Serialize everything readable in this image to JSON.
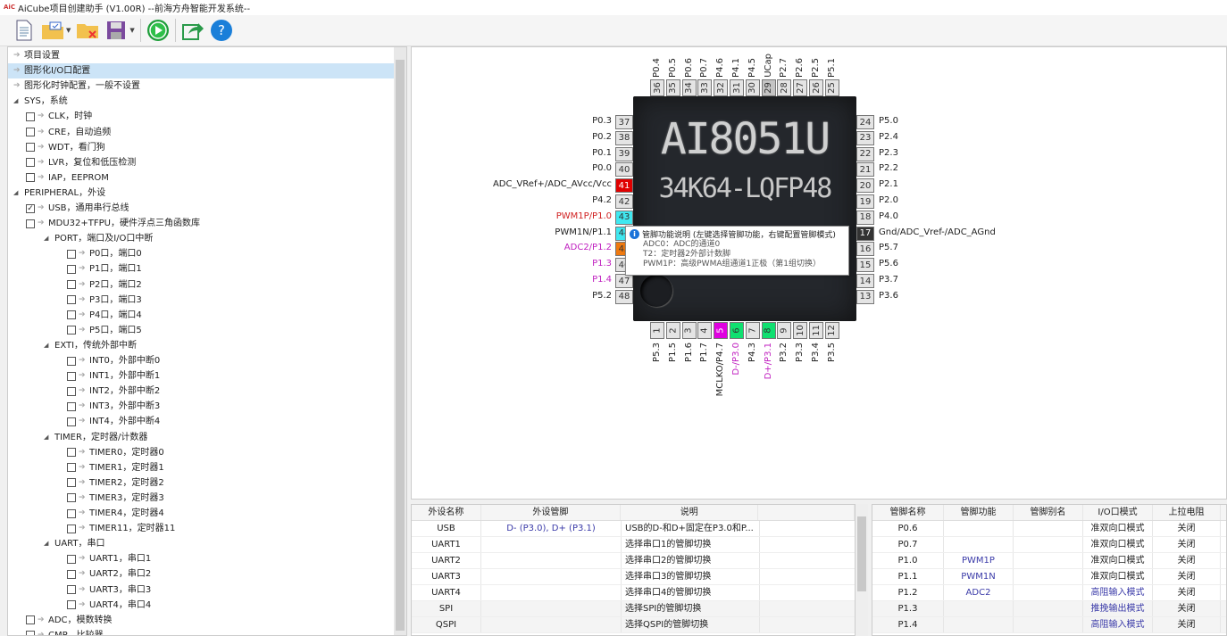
{
  "window": {
    "title": "AiCube项目创建助手 (V1.00R) --前海方舟智能开发系统--",
    "logo": "AiC Cube"
  },
  "toolbar": [
    "new-file-icon",
    "open-project-icon",
    "close-project-icon",
    "save-icon",
    "run-icon",
    "export-icon",
    "help-icon"
  ],
  "tree": [
    {
      "label": "项目设置",
      "level": 0,
      "type": "arrow"
    },
    {
      "label": "图形化I/O口配置",
      "level": 0,
      "type": "arrow",
      "selected": true
    },
    {
      "label": "图形化时钟配置，一般不设置",
      "level": 0,
      "type": "arrow"
    },
    {
      "label": "SYS，系统",
      "level": 0,
      "type": "group"
    },
    {
      "label": "CLK，时钟",
      "level": 1,
      "type": "check"
    },
    {
      "label": "CRE，自动追频",
      "level": 1,
      "type": "check"
    },
    {
      "label": "WDT，看门狗",
      "level": 1,
      "type": "check"
    },
    {
      "label": "LVR，复位和低压检测",
      "level": 1,
      "type": "check"
    },
    {
      "label": "IAP，EEPROM",
      "level": 1,
      "type": "check"
    },
    {
      "label": "PERIPHERAL，外设",
      "level": 0,
      "type": "group"
    },
    {
      "label": "USB，通用串行总线",
      "level": 1,
      "type": "check",
      "checked": true
    },
    {
      "label": "MDU32+TFPU，硬件浮点三角函数库",
      "level": 1,
      "type": "check"
    },
    {
      "label": "PORT，端口及I/O口中断",
      "level": 2,
      "type": "group"
    },
    {
      "label": "P0口，端口0",
      "level": 3,
      "type": "check"
    },
    {
      "label": "P1口，端口1",
      "level": 3,
      "type": "check"
    },
    {
      "label": "P2口，端口2",
      "level": 3,
      "type": "check"
    },
    {
      "label": "P3口，端口3",
      "level": 3,
      "type": "check"
    },
    {
      "label": "P4口，端口4",
      "level": 3,
      "type": "check"
    },
    {
      "label": "P5口，端口5",
      "level": 3,
      "type": "check"
    },
    {
      "label": "EXTI，传统外部中断",
      "level": 2,
      "type": "group"
    },
    {
      "label": "INT0，外部中断0",
      "level": 3,
      "type": "check"
    },
    {
      "label": "INT1，外部中断1",
      "level": 3,
      "type": "check"
    },
    {
      "label": "INT2，外部中断2",
      "level": 3,
      "type": "check"
    },
    {
      "label": "INT3，外部中断3",
      "level": 3,
      "type": "check"
    },
    {
      "label": "INT4，外部中断4",
      "level": 3,
      "type": "check"
    },
    {
      "label": "TIMER，定时器/计数器",
      "level": 2,
      "type": "group"
    },
    {
      "label": "TIMER0，定时器0",
      "level": 3,
      "type": "check"
    },
    {
      "label": "TIMER1，定时器1",
      "level": 3,
      "type": "check"
    },
    {
      "label": "TIMER2，定时器2",
      "level": 3,
      "type": "check"
    },
    {
      "label": "TIMER3，定时器3",
      "level": 3,
      "type": "check"
    },
    {
      "label": "TIMER4，定时器4",
      "level": 3,
      "type": "check"
    },
    {
      "label": "TIMER11，定时器11",
      "level": 3,
      "type": "check"
    },
    {
      "label": "UART，串口",
      "level": 2,
      "type": "group"
    },
    {
      "label": "UART1，串口1",
      "level": 3,
      "type": "check"
    },
    {
      "label": "UART2，串口2",
      "level": 3,
      "type": "check"
    },
    {
      "label": "UART3，串口3",
      "level": 3,
      "type": "check"
    },
    {
      "label": "UART4，串口4",
      "level": 3,
      "type": "check"
    },
    {
      "label": "ADC，模数转换",
      "level": 1,
      "type": "check"
    },
    {
      "label": "CMP，比较器",
      "level": 1,
      "type": "check"
    }
  ],
  "chip": {
    "name": "AI8051U",
    "package": "34K64-LQFP48",
    "colors": {
      "red": "#e00000",
      "cyan": "#40e8f0",
      "orange": "#f07a10",
      "magenta": "#e000e0",
      "green": "#10e070",
      "dark": "#333333",
      "gray": "#c4c4c4",
      "label_red": "#d02020",
      "label_magenta": "#c020c0"
    },
    "top": [
      {
        "num": "36",
        "label": "P0.4"
      },
      {
        "num": "35",
        "label": "P0.5"
      },
      {
        "num": "34",
        "label": "P0.6"
      },
      {
        "num": "33",
        "label": "P0.7"
      },
      {
        "num": "32",
        "label": "P4.6"
      },
      {
        "num": "31",
        "label": "P4.1"
      },
      {
        "num": "30",
        "label": "P4.5"
      },
      {
        "num": "29",
        "label": "UCap",
        "fill": "gray"
      },
      {
        "num": "28",
        "label": "P2.7"
      },
      {
        "num": "27",
        "label": "P2.6"
      },
      {
        "num": "26",
        "label": "P2.5"
      },
      {
        "num": "25",
        "label": "P5.1"
      }
    ],
    "left": [
      {
        "num": "37",
        "label": "P0.3"
      },
      {
        "num": "38",
        "label": "P0.2"
      },
      {
        "num": "39",
        "label": "P0.1"
      },
      {
        "num": "40",
        "label": "P0.0"
      },
      {
        "num": "41",
        "label": "ADC_VRef+/ADC_AVcc/Vcc",
        "fill": "red"
      },
      {
        "num": "42",
        "label": "P4.2"
      },
      {
        "num": "43",
        "label": "PWM1P/P1.0",
        "fill": "cyan",
        "lc": "label_red"
      },
      {
        "num": "44",
        "label": "PWM1N/P1.1",
        "fill": "cyan"
      },
      {
        "num": "45",
        "label": "ADC2/P1.2",
        "fill": "orange",
        "lc": "label_magenta"
      },
      {
        "num": "46",
        "label": "P1.3",
        "lc": "label_magenta"
      },
      {
        "num": "47",
        "label": "P1.4",
        "lc": "label_magenta"
      },
      {
        "num": "48",
        "label": "P5.2"
      }
    ],
    "right": [
      {
        "num": "24",
        "label": "P5.0"
      },
      {
        "num": "23",
        "label": "P2.4"
      },
      {
        "num": "22",
        "label": "P2.3"
      },
      {
        "num": "21",
        "label": "P2.2"
      },
      {
        "num": "20",
        "label": "P2.1"
      },
      {
        "num": "19",
        "label": "P2.0"
      },
      {
        "num": "18",
        "label": "P4.0"
      },
      {
        "num": "17",
        "label": "Gnd/ADC_Vref-/ADC_AGnd",
        "fill": "dark"
      },
      {
        "num": "16",
        "label": "P5.7"
      },
      {
        "num": "15",
        "label": "P5.6"
      },
      {
        "num": "14",
        "label": "P3.7"
      },
      {
        "num": "13",
        "label": "P3.6"
      }
    ],
    "bottom": [
      {
        "num": "1",
        "label": "P5.3"
      },
      {
        "num": "2",
        "label": "P1.5"
      },
      {
        "num": "3",
        "label": "P1.6"
      },
      {
        "num": "4",
        "label": "P1.7"
      },
      {
        "num": "5",
        "label": "MCLKO/P4.7",
        "fill": "magenta"
      },
      {
        "num": "6",
        "label": "D-/P3.0",
        "fill": "green",
        "lc": "label_magenta"
      },
      {
        "num": "7",
        "label": "P4.3"
      },
      {
        "num": "8",
        "label": "D+/P3.1",
        "fill": "green",
        "lc": "label_magenta"
      },
      {
        "num": "9",
        "label": "P3.2"
      },
      {
        "num": "10",
        "label": "P3.3"
      },
      {
        "num": "11",
        "label": "P3.4"
      },
      {
        "num": "12",
        "label": "P3.5"
      }
    ]
  },
  "tooltip": {
    "title": "管脚功能说明 (左键选择管脚功能，右键配置管脚模式)",
    "lines": [
      "ADC0：ADC的通道0",
      "T2：定时器2外部计数脚",
      "PWM1P：高级PWMA组通道1正极（第1组切换）"
    ]
  },
  "peripheral_table": {
    "headers": [
      "外设名称",
      "外设管脚",
      "说明",
      ""
    ],
    "rows": [
      [
        "USB",
        "D- (P3.0), D+ (P3.1)",
        "USB的D-和D+固定在P3.0和P..."
      ],
      [
        "UART1",
        "",
        "选择串口1的管脚切换"
      ],
      [
        "UART2",
        "",
        "选择串口2的管脚切换"
      ],
      [
        "UART3",
        "",
        "选择串口3的管脚切换"
      ],
      [
        "UART4",
        "",
        "选择串口4的管脚切换"
      ],
      [
        "SPI",
        "",
        "选择SPI的管脚切换"
      ],
      [
        "QSPI",
        "",
        "选择QSPI的管脚切换"
      ]
    ]
  },
  "pin_table": {
    "headers": [
      "管脚名称",
      "管脚功能",
      "管脚别名",
      "I/O口模式",
      "上拉电阻"
    ],
    "rows": [
      [
        "P0.6",
        "",
        "",
        "准双向口模式",
        "关闭"
      ],
      [
        "P0.7",
        "",
        "",
        "准双向口模式",
        "关闭"
      ],
      [
        "P1.0",
        "PWM1P",
        "",
        "准双向口模式",
        "关闭"
      ],
      [
        "P1.1",
        "PWM1N",
        "",
        "准双向口模式",
        "关闭"
      ],
      [
        "P1.2",
        "ADC2",
        "",
        "高阻输入模式",
        "关闭"
      ],
      [
        "P1.3",
        "",
        "",
        "推挽输出模式",
        "关闭"
      ],
      [
        "P1.4",
        "",
        "",
        "高阻输入模式",
        "关闭"
      ]
    ]
  }
}
